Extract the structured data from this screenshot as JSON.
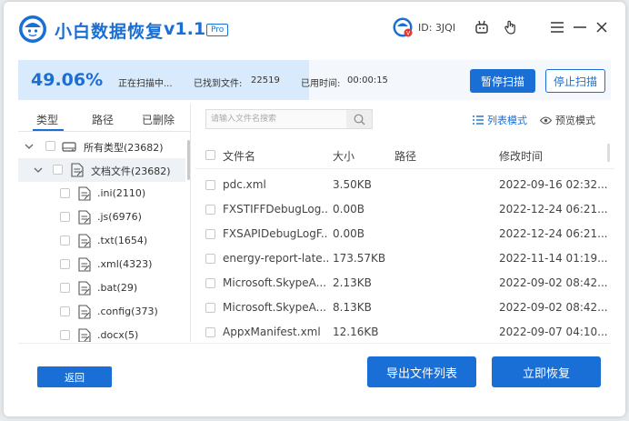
{
  "app": {
    "title": "小白数据恢复",
    "version": "v1.1",
    "badge": "Pro",
    "user_id": "ID: 3JQI",
    "accent_color": "#1a6fd6"
  },
  "scan": {
    "percent_text": "49.06%",
    "progress": 0.4906,
    "status": "正在扫描中...",
    "found_label": "已找到文件:",
    "found_count": "22519",
    "time_label": "已用时间:",
    "time_value": "00:00:15",
    "pause_label": "暂停扫描",
    "stop_label": "停止扫描"
  },
  "left_tabs": [
    "类型",
    "路径",
    "已删除"
  ],
  "tree": [
    {
      "label": "所有类型(23682)",
      "icon": "drive-icon"
    },
    {
      "label": "文档文件(23682)",
      "icon": "document-icon"
    },
    {
      "label": ".ini(2110)",
      "icon": "document-icon"
    },
    {
      "label": ".js(6976)",
      "icon": "document-icon"
    },
    {
      "label": ".txt(1654)",
      "icon": "document-icon"
    },
    {
      "label": ".xml(4323)",
      "icon": "document-icon"
    },
    {
      "label": ".bat(29)",
      "icon": "document-icon"
    },
    {
      "label": ".config(373)",
      "icon": "document-icon"
    },
    {
      "label": ".docx(5)",
      "icon": "document-icon"
    }
  ],
  "search": {
    "placeholder": "请输入文件名搜索"
  },
  "view": {
    "list_label": "列表模式",
    "preview_label": "预览模式"
  },
  "table": {
    "headers": [
      "文件名",
      "大小",
      "路径",
      "修改时间"
    ],
    "rows": [
      {
        "name": "pdc.xml",
        "size": "3.50KB",
        "path": "",
        "modified": "2022-09-16 02:32..."
      },
      {
        "name": "FXSTIFFDebugLog...",
        "size": "0.00B",
        "path": "",
        "modified": "2022-12-24 06:21..."
      },
      {
        "name": "FXSAPIDebugLogF...",
        "size": "0.00B",
        "path": "",
        "modified": "2022-12-24 06:21..."
      },
      {
        "name": "energy-report-late...",
        "size": "173.57KB",
        "path": "",
        "modified": "2022-11-14 01:19..."
      },
      {
        "name": "Microsoft.SkypeA...",
        "size": "2.13KB",
        "path": "",
        "modified": "2022-09-02 08:42..."
      },
      {
        "name": "Microsoft.SkypeA...",
        "size": "8.13KB",
        "path": "",
        "modified": "2022-09-02 08:42..."
      },
      {
        "name": "AppxManifest.xml",
        "size": "12.16KB",
        "path": "",
        "modified": "2022-09-07 04:10..."
      }
    ]
  },
  "footer": {
    "back_label": "返回",
    "export_label": "导出文件列表",
    "recover_label": "立即恢复"
  }
}
